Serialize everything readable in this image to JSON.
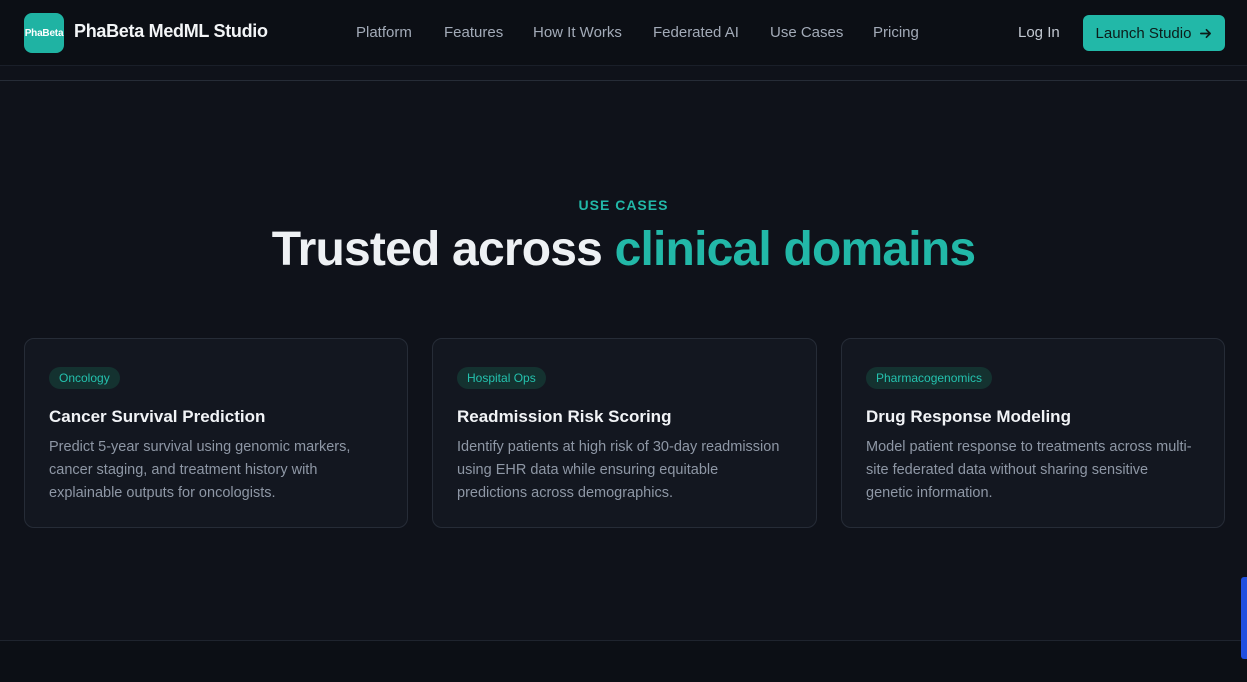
{
  "brand": {
    "logo_text": "PhaBeta",
    "name": "PhaBeta MedML Studio"
  },
  "nav": {
    "links": [
      "Platform",
      "Features",
      "How It Works",
      "Federated AI",
      "Use Cases",
      "Pricing"
    ],
    "login": "Log In",
    "cta": "Launch Studio"
  },
  "section": {
    "eyebrow": "USE CASES",
    "title_main": "Trusted across ",
    "title_accent": "clinical domains"
  },
  "cards": [
    {
      "badge": "Oncology",
      "title": "Cancer Survival Prediction",
      "description": "Predict 5-year survival using genomic markers, cancer staging, and treatment history with explainable outputs for oncologists."
    },
    {
      "badge": "Hospital Ops",
      "title": "Readmission Risk Scoring",
      "description": "Identify patients at high risk of 30-day readmission using EHR data while ensuring equitable predictions across demographics."
    },
    {
      "badge": "Pharmacogenomics",
      "title": "Drug Response Modeling",
      "description": "Model patient response to treatments across multi-site federated data without sharing sensitive genetic information."
    }
  ],
  "colors": {
    "accent": "#22b8a8",
    "background": "#0f121a",
    "card": "#131720"
  },
  "icons": {
    "cta_arrow": "arrow-right-icon"
  }
}
